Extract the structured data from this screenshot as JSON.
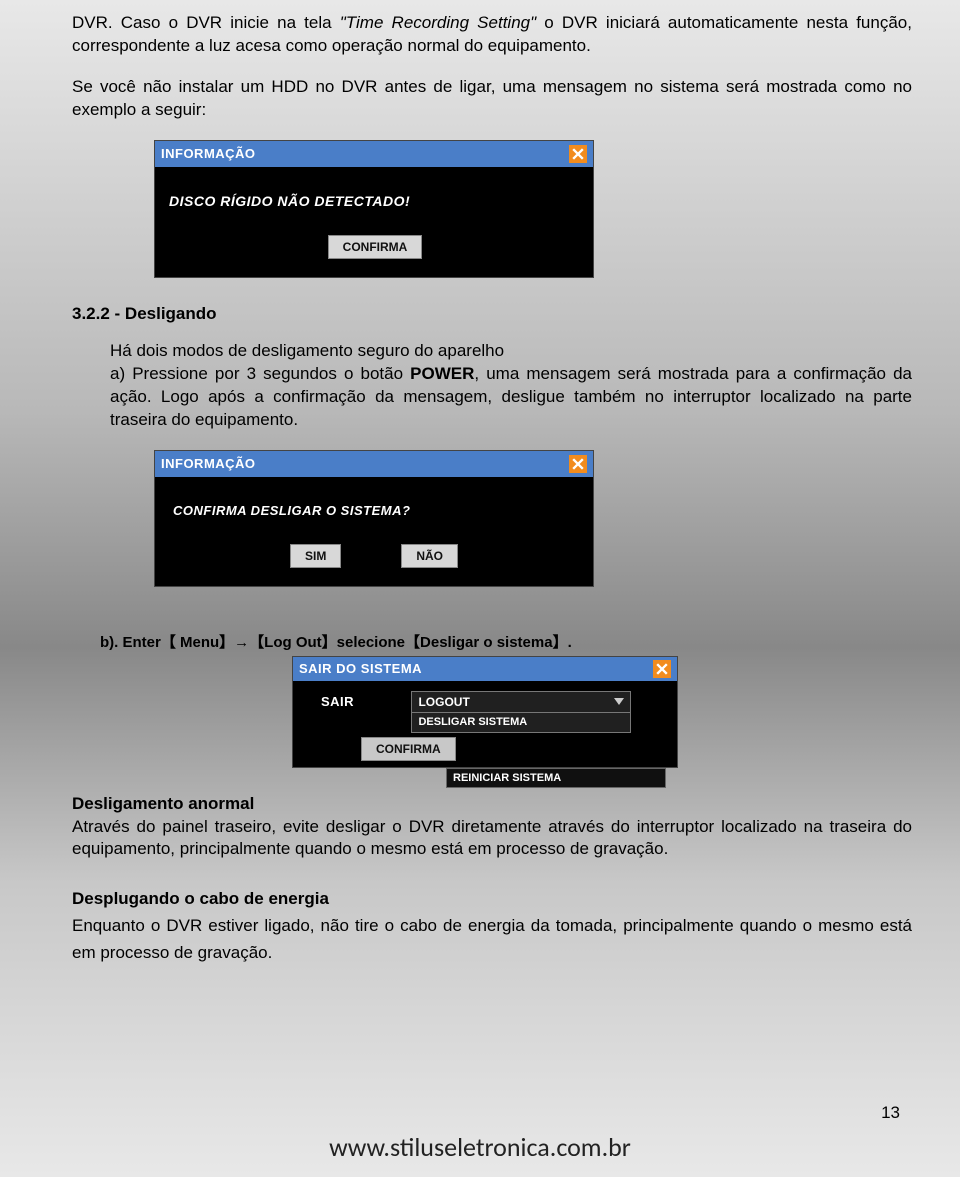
{
  "paragraphs": {
    "p1_prefix": "DVR. Caso o DVR inicie na tela ",
    "p1_ital": "\"Time Recording Setting\"",
    "p1_suffix": " o DVR iniciará automaticamente nesta função, correspondente a luz acesa como operação normal do equipamento.",
    "p2": "Se você não instalar um HDD no DVR antes de ligar, uma mensagem no sistema será mostrada como no exemplo a seguir:"
  },
  "dialog1": {
    "title": "INFORMAÇÃO",
    "message": "DISCO RÍGIDO NÃO DETECTADO!",
    "confirm": "CONFIRMA"
  },
  "section322": {
    "heading": "3.2.2 - Desligando",
    "body_a_prefix": "Há dois modos de desligamento seguro do aparelho",
    "body_a_line2_pre": "a) Pressione por 3 segundos o botão ",
    "body_a_power": "POWER",
    "body_a_line2_post": ", uma mensagem será mostrada para a confirmação da ação.  Logo após a confirmação da mensagem, desligue também no interruptor localizado na parte traseira do equipamento."
  },
  "dialog2": {
    "title": "INFORMAÇÃO",
    "message": "CONFIRMA DESLIGAR O SISTEMA?",
    "yes": "SIM",
    "no": "NÃO"
  },
  "step_b": "b). Enter【 Menu】→【Log Out】selecione【Desligar o sistema】.",
  "dialog3": {
    "title": "SAIR DO SISTEMA",
    "label": "SAIR",
    "selected": "LOGOUT",
    "opt2": "DESLIGAR SISTEMA",
    "confirm": "CONFIRMA",
    "opt3": "REINICIAR SISTEMA"
  },
  "abnormal": {
    "heading": "Desligamento anormal",
    "body": "Através do painel traseiro, evite desligar o DVR diretamente através do interruptor localizado na traseira do equipamento, principalmente quando o mesmo está em processo de gravação."
  },
  "unplug": {
    "heading": "Desplugando o cabo de energia",
    "body": "Enquanto o DVR estiver ligado, não tire o cabo de energia da tomada, principalmente quando o mesmo está em processo de gravação."
  },
  "footer_url": "www.stiluseletronica.com.br",
  "page_number": "13"
}
